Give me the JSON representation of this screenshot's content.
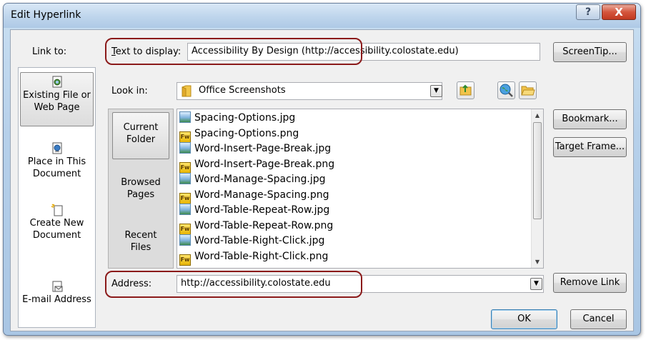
{
  "window": {
    "title": "Edit Hyperlink",
    "help_glyph": "?",
    "close_glyph": "X"
  },
  "link_to": {
    "label": "Link to:",
    "items": [
      {
        "label_line1": "Existing File or",
        "label_line2": "Web Page",
        "icon": "existing-file-icon",
        "selected": true
      },
      {
        "label_line1": "Place in This",
        "label_line2": "Document",
        "icon": "place-in-document-icon",
        "selected": false
      },
      {
        "label_line1": "Create New",
        "label_line2": "Document",
        "icon": "new-document-icon",
        "selected": false
      },
      {
        "label_line1": "E-mail Address",
        "label_line2": "",
        "icon": "email-icon",
        "selected": false
      }
    ]
  },
  "text_to_display": {
    "label": "Text to display:",
    "value": "Accessibility By Design (http://accessibility.colostate.edu)"
  },
  "look_in": {
    "label": "Look in:",
    "value": "Office Screenshots"
  },
  "sub_nav": {
    "items": [
      {
        "line1": "Current",
        "line2": "Folder",
        "selected": true
      },
      {
        "line1": "Browsed",
        "line2": "Pages",
        "selected": false
      },
      {
        "line1": "Recent",
        "line2": "Files",
        "selected": false
      }
    ]
  },
  "files": [
    {
      "name": "Spacing-Options.jpg",
      "type": "jpg"
    },
    {
      "name": "Spacing-Options.png",
      "type": "png"
    },
    {
      "name": "Word-Insert-Page-Break.jpg",
      "type": "jpg"
    },
    {
      "name": "Word-Insert-Page-Break.png",
      "type": "png"
    },
    {
      "name": "Word-Manage-Spacing.jpg",
      "type": "jpg"
    },
    {
      "name": "Word-Manage-Spacing.png",
      "type": "png"
    },
    {
      "name": "Word-Table-Repeat-Row.jpg",
      "type": "jpg"
    },
    {
      "name": "Word-Table-Repeat-Row.png",
      "type": "png"
    },
    {
      "name": "Word-Table-Right-Click.jpg",
      "type": "jpg"
    },
    {
      "name": "Word-Table-Right-Click.png",
      "type": "png"
    }
  ],
  "fw_badge": "Fw",
  "address": {
    "label": "Address:",
    "value": "http://accessibility.colostate.edu"
  },
  "buttons": {
    "screentip": "ScreenTip...",
    "bookmark": "Bookmark...",
    "target_frame": "Target Frame...",
    "remove_link": "Remove Link",
    "ok": "OK",
    "cancel": "Cancel"
  },
  "colors": {
    "highlight": "#8b1a1a",
    "close": "#c23a21"
  }
}
